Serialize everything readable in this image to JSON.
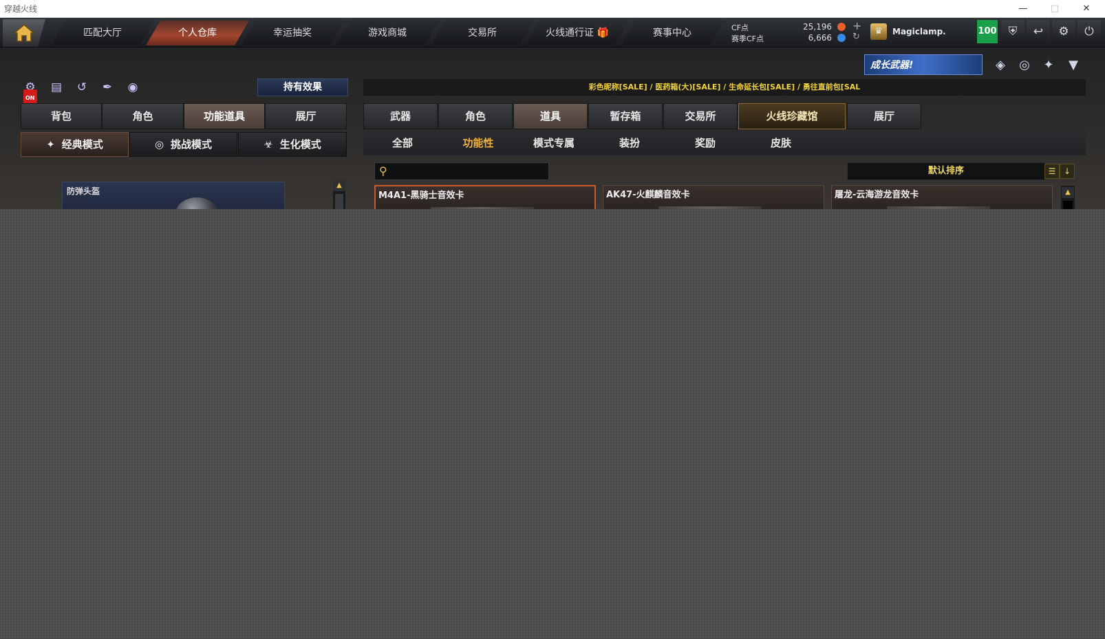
{
  "window": {
    "title": "穿越火线"
  },
  "topnav": {
    "tabs": [
      {
        "label": "匹配大厅"
      },
      {
        "label": "个人仓库"
      },
      {
        "label": "幸运抽奖"
      },
      {
        "label": "游戏商城"
      },
      {
        "label": "交易所"
      },
      {
        "label": "火线通行证"
      },
      {
        "label": "赛事中心"
      }
    ],
    "active_tab": "个人仓库"
  },
  "currency": {
    "cf_label": "CF点",
    "cf_value": "25,196",
    "season_label": "赛季CF点",
    "season_value": "6,666"
  },
  "user": {
    "name": "Magiclamp.",
    "level": "100"
  },
  "banner": {
    "text": "成长武器!"
  },
  "left_panel": {
    "hold_effect_label": "持有效果",
    "on_label": "ON",
    "tabs": [
      {
        "label": "背包"
      },
      {
        "label": "角色"
      },
      {
        "label": "功能道具"
      },
      {
        "label": "展厅"
      }
    ],
    "active_tab": "功能道具",
    "modes": [
      {
        "label": "经典模式"
      },
      {
        "label": "挑战模式"
      },
      {
        "label": "生化模式"
      }
    ],
    "active_mode": "经典模式",
    "items": [
      {
        "name": "防弹头盔"
      }
    ]
  },
  "right_panel": {
    "ticker": "彩色昵称[SALE] / 医药箱(大)[SALE] / 生命延长包[SALE] / 勇往直前包[SAL",
    "tabs": [
      {
        "label": "武器"
      },
      {
        "label": "角色"
      },
      {
        "label": "道具"
      },
      {
        "label": "暂存箱"
      },
      {
        "label": "交易所"
      },
      {
        "label": "火线珍藏馆"
      },
      {
        "label": "展厅"
      }
    ],
    "active_tab": "道具",
    "highlight_tab": "火线珍藏馆",
    "subtabs": [
      {
        "label": "全部"
      },
      {
        "label": "功能性"
      },
      {
        "label": "模式专属"
      },
      {
        "label": "装扮"
      },
      {
        "label": "奖励"
      },
      {
        "label": "皮肤"
      }
    ],
    "active_subtab": "功能性",
    "search": {
      "value": "",
      "placeholder": ""
    },
    "sort_label": "默认排序",
    "cards": [
      {
        "name": "M4A1-黑骑士音效卡"
      },
      {
        "name": "AK47-火麒麟音效卡"
      },
      {
        "name": "屠龙-云海游龙音效卡"
      }
    ]
  },
  "icons": {
    "home": "home-icon",
    "shield": "shield-icon",
    "exit_room": "exit-icon",
    "settings": "gear-icon",
    "power": "power-icon"
  },
  "colors": {
    "accent_active": "#a2452e",
    "gold_text": "#f3d33a",
    "level_green": "#1aa04a"
  }
}
